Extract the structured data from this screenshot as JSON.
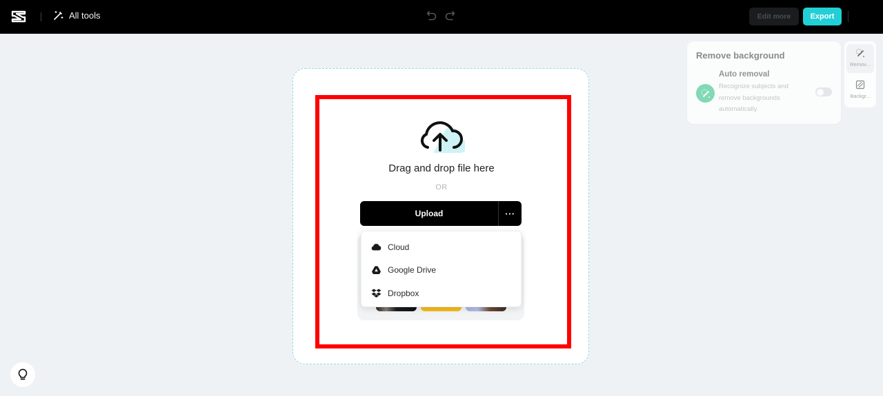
{
  "topbar": {
    "logo": "capcut-logo-icon",
    "all_tools_label": "All tools",
    "undo_icon": "undo-icon",
    "redo_icon": "redo-icon",
    "edit_more_label": "Edit more",
    "export_label": "Export"
  },
  "upload": {
    "drag_text": "Drag and drop file here",
    "or_text": "OR",
    "upload_label": "Upload",
    "more_label": "···",
    "menu": [
      {
        "label": "Cloud",
        "icon": "cloud-icon"
      },
      {
        "label": "Google Drive",
        "icon": "google-drive-icon"
      },
      {
        "label": "Dropbox",
        "icon": "dropbox-icon"
      }
    ]
  },
  "remove_background": {
    "title": "Remove background",
    "auto_removal": {
      "title": "Auto removal",
      "description": "Recognize subjects and remove backgrounds automatically.",
      "enabled": false
    }
  },
  "side_rail": [
    {
      "label": "Remov...",
      "icon": "remove-bg-icon",
      "active": true
    },
    {
      "label": "Backgr...",
      "icon": "background-icon",
      "active": false
    }
  ],
  "colors": {
    "accent": "#22cfd6",
    "highlight": "#ff0000",
    "auto_removal_icon_bg": "#63d3a4"
  }
}
